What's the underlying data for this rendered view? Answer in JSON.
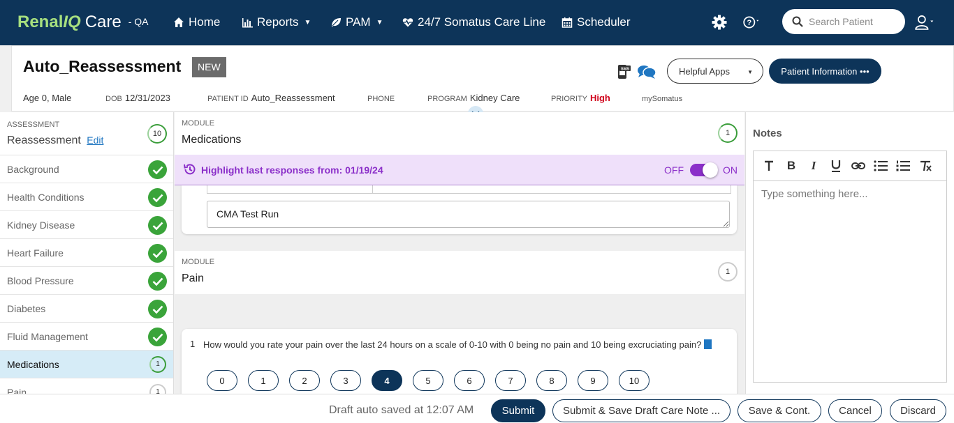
{
  "brand": {
    "name_part1": "Renal",
    "name_part2": "IQ",
    "name_part3": "Care",
    "env": "- QA"
  },
  "nav": {
    "home": "Home",
    "reports": "Reports",
    "pam": "PAM",
    "careline": "24/7 Somatus Care Line",
    "scheduler": "Scheduler",
    "search_placeholder": "Search Patient"
  },
  "patient": {
    "title": "Auto_Reassessment",
    "badge": "NEW",
    "age_sex": "Age 0, Male",
    "dob_label": "DOB",
    "dob": "12/31/2023",
    "pid_label": "PATIENT ID",
    "pid": "Auto_Reassessment",
    "phone_label": "PHONE",
    "program_label": "PROGRAM",
    "program": "Kidney Care",
    "priority_label": "PRIORITY",
    "priority": "High",
    "mysomatus": "mySomatus",
    "helpful_apps": "Helpful Apps",
    "patient_info": "Patient Information •••"
  },
  "sidebar": {
    "section_label": "ASSESSMENT",
    "assessment": "Reassessment",
    "edit": "Edit",
    "count": "10",
    "items": [
      {
        "label": "Background",
        "status": "done"
      },
      {
        "label": "Health Conditions",
        "status": "done"
      },
      {
        "label": "Kidney Disease",
        "status": "done"
      },
      {
        "label": "Heart Failure",
        "status": "done"
      },
      {
        "label": "Blood Pressure",
        "status": "done"
      },
      {
        "label": "Diabetes",
        "status": "done"
      },
      {
        "label": "Fluid Management",
        "status": "done"
      },
      {
        "label": "Medications",
        "status": "active",
        "count": "1"
      },
      {
        "label": "Pain",
        "status": "pending",
        "count": "1"
      }
    ]
  },
  "main": {
    "module_label": "MODULE",
    "module1": "Medications",
    "module1_count": "1",
    "highlight_text": "Highlight last responses from: 01/19/24",
    "toggle_off": "OFF",
    "toggle_on": "ON",
    "textarea_value": "CMA Test Run",
    "module2": "Pain",
    "module2_count": "1",
    "question_num": "1",
    "question_text": "How would you rate your pain over the last 24 hours on a scale of 0-10 with 0 being no pain and 10 being excruciating pain?",
    "options": [
      "0",
      "1",
      "2",
      "3",
      "4",
      "5",
      "6",
      "7",
      "8",
      "9",
      "10"
    ],
    "selected": "4"
  },
  "notes": {
    "title": "Notes",
    "placeholder": "Type something here..."
  },
  "footer": {
    "draft": "Draft auto saved at 12:07 AM",
    "submit": "Submit",
    "submit_save": "Submit & Save Draft Care Note ...",
    "save_cont": "Save & Cont.",
    "cancel": "Cancel",
    "discard": "Discard"
  },
  "colors": {
    "navy": "#0d3459",
    "green": "#3aa43a",
    "purple": "#8b2fc9",
    "priority_high": "#d0021b"
  }
}
